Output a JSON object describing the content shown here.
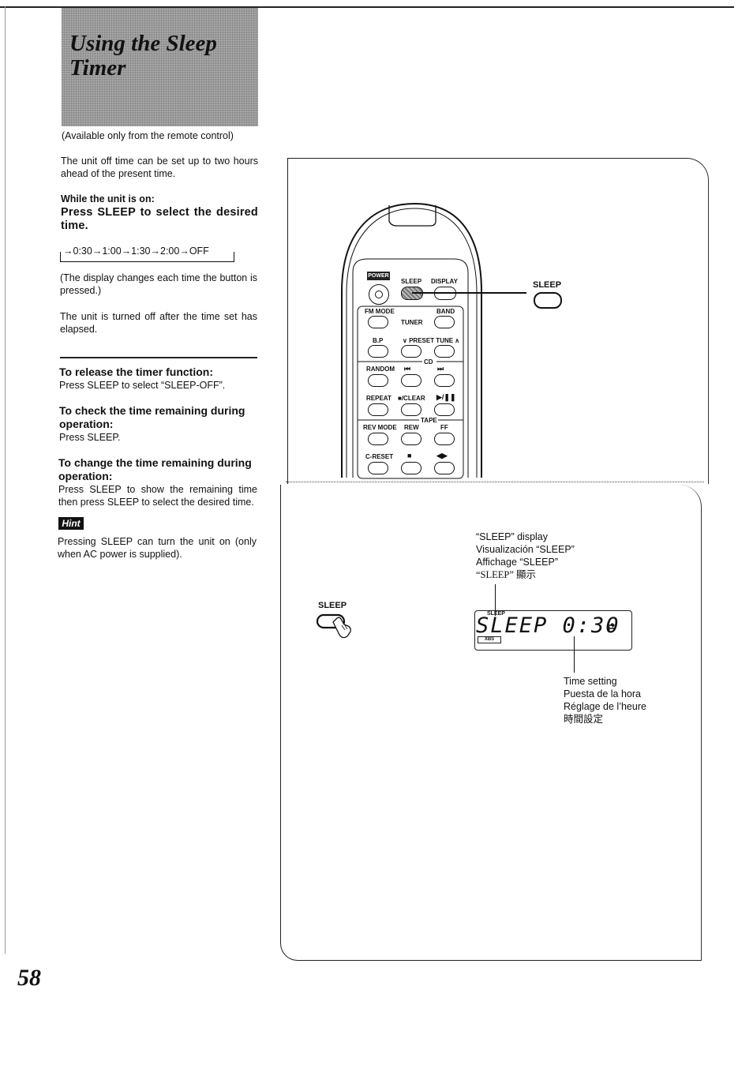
{
  "title": {
    "line1": "Using the Sleep",
    "line2": "Timer"
  },
  "availability_note": "(Available only from the remote control)",
  "intro": "The unit off time can be set up to two hours ahead of the present time.",
  "step": {
    "condition": "While the unit is on:",
    "instruction": "Press SLEEP to select the desired time.",
    "cycle": [
      "0:30",
      "1:00",
      "1:30",
      "2:00",
      "OFF"
    ],
    "cycle_text": "→0:30→1:00→1:30→2:00→OFF",
    "display_note": "(The display changes each time the button is pressed.)",
    "result_note": "The unit is turned off after the time set has elapsed."
  },
  "sections": [
    {
      "heading": "To release the timer function:",
      "body": "Press SLEEP to select “SLEEP-OFF”."
    },
    {
      "heading": "To check the time remaining during operation:",
      "body": "Press SLEEP."
    },
    {
      "heading": "To change the time remaining during operation:",
      "body": "Press SLEEP to show the remaining time then press SLEEP to select the desired time."
    }
  ],
  "hint": {
    "label": "Hint",
    "body": "Pressing SLEEP can turn the unit on (only when AC power is supplied)."
  },
  "page_number": "58",
  "remote": {
    "power": "POWER",
    "row1": [
      "SLEEP",
      "DISPLAY"
    ],
    "tuner": {
      "section": "TUNER",
      "fm_mode": "FM MODE",
      "band": "BAND",
      "bp": "B.P",
      "preset": "∨ PRESET TUNE ∧"
    },
    "cd": {
      "section": "CD",
      "random": "RANDOM",
      "prev": "⏮",
      "next": "⏭",
      "repeat": "REPEAT",
      "clear": "■/CLEAR",
      "play": "▶/❚❚"
    },
    "tape": {
      "section": "TAPE",
      "rev_mode": "REV MODE",
      "rew": "REW",
      "ff": "FF",
      "creset": "C-RESET",
      "stop": "■",
      "dir": "◀▶"
    }
  },
  "callout_sleep": "SLEEP",
  "press_sleep": "SLEEP",
  "display_caption": [
    "“SLEEP” display",
    "Visualización “SLEEP”",
    "Affichage “SLEEP”",
    "“SLEEP” 顯示"
  ],
  "lcd": {
    "indicator": "SLEEP",
    "text": "SLEEP 0:30",
    "xbs": "XBS",
    "icon": "⇄"
  },
  "time_caption": [
    "Time setting",
    "Puesta de la hora",
    "Réglage de l’heure",
    "時間設定"
  ]
}
